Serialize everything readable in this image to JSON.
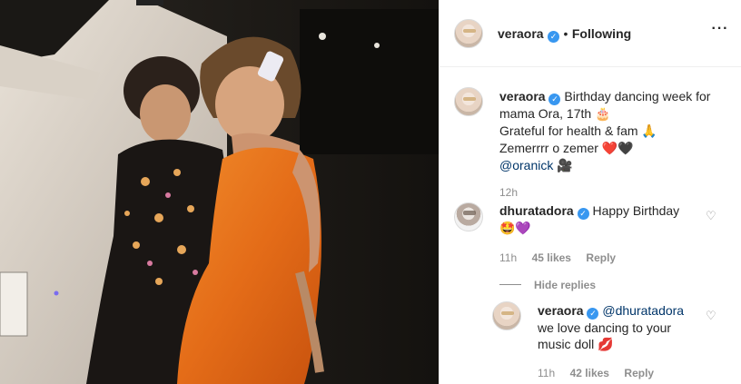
{
  "header": {
    "username": "veraora",
    "separator": "•",
    "follow_status": "Following",
    "more_icon": "more-options-icon"
  },
  "caption": {
    "username": "veraora",
    "line1": "Birthday dancing week for mama Ora, 17th",
    "line1_emoji": "🎂",
    "line2": "Grateful for health & fam",
    "line2_emoji": "🙏",
    "line3": "Zemerrrr o zemer",
    "line3_emoji": "❤️🖤",
    "mention": "@oranick",
    "mention_emoji": "🎥",
    "time": "12h"
  },
  "comment1": {
    "username": "dhuratadora",
    "text": "Happy Birthday",
    "emoji": "🤩💜",
    "time": "11h",
    "likes": "45 likes",
    "reply_label": "Reply",
    "hide_replies": "Hide replies"
  },
  "reply1": {
    "username": "veraora",
    "mention": "@dhuratadora",
    "text_line1": "we love dancing to your",
    "text_line2": "music doll",
    "emoji": "💋",
    "time": "11h",
    "likes": "42 likes",
    "reply_label": "Reply"
  },
  "colors": {
    "verified_blue": "#3897f0",
    "link_blue": "#003569",
    "meta_gray": "#8e8e8e",
    "dress_orange": "#e8721f"
  }
}
